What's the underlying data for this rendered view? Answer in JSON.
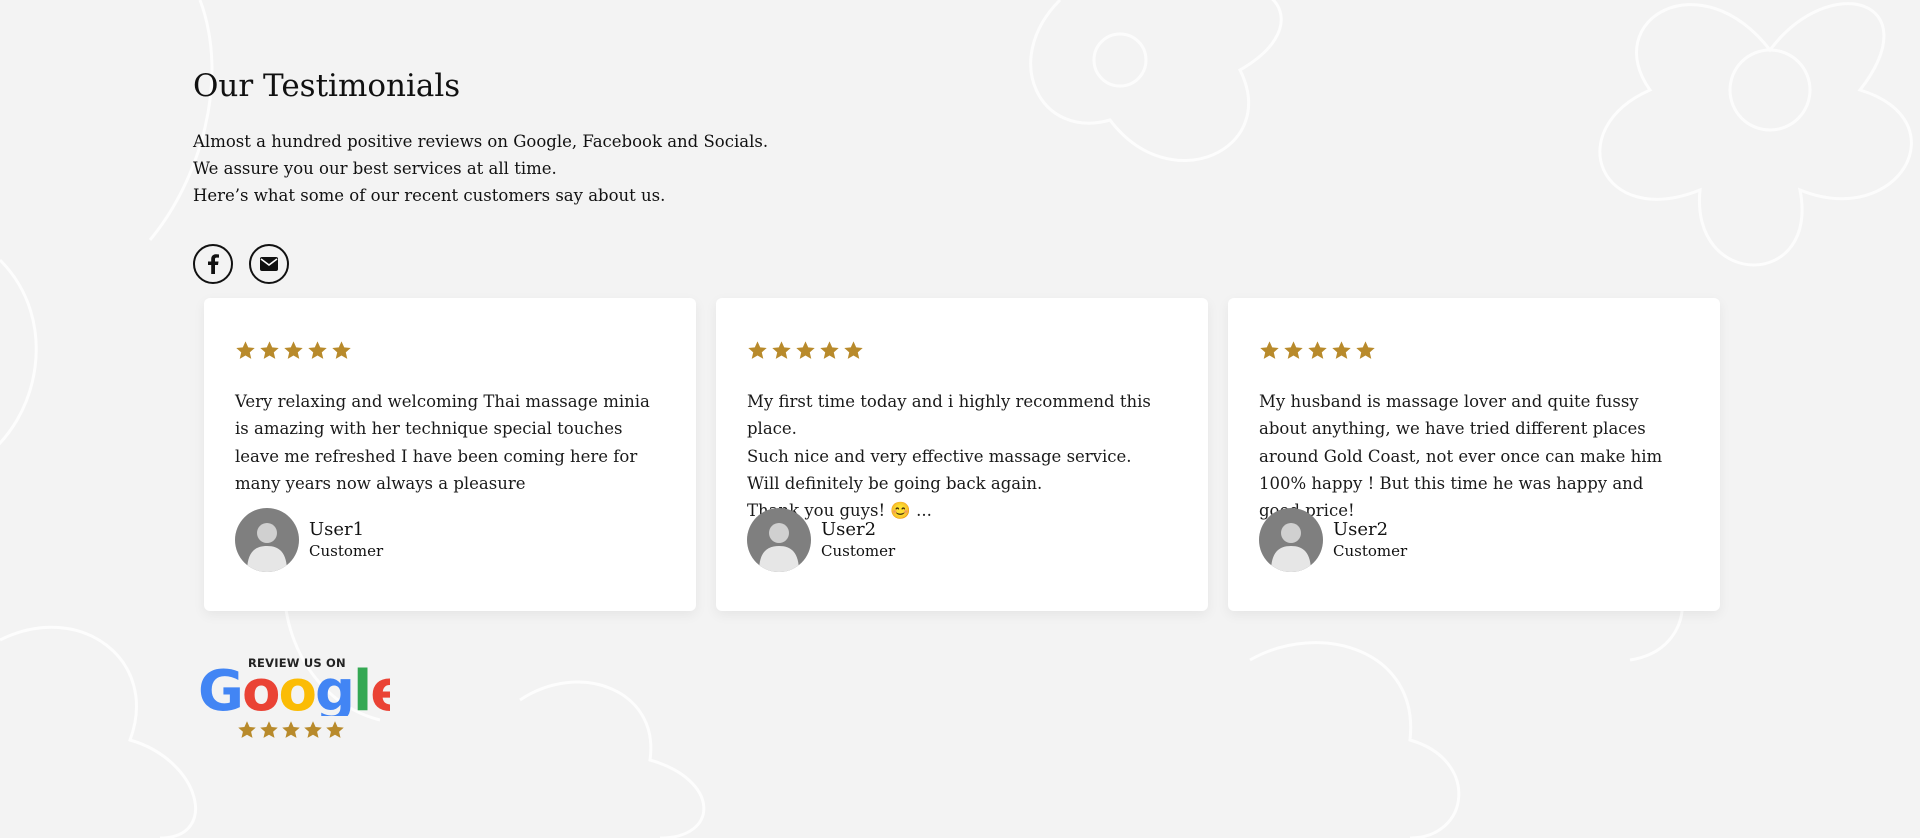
{
  "section": {
    "title": "Our Testimonials",
    "intro_lines": [
      "Almost a hundred positive reviews on Google, Facebook and Socials.",
      "We assure you our best services at all time.",
      "Here’s what some of our recent customers say about us."
    ]
  },
  "social": [
    {
      "icon": "facebook-icon"
    },
    {
      "icon": "envelope-icon"
    }
  ],
  "testimonials": [
    {
      "rating": 5,
      "quote": "Very relaxing and welcoming Thai massage minia is amazing with her technique special touches leave me refreshed I have been coming here for many years now always a pleasure",
      "name": "User1",
      "role": "Customer"
    },
    {
      "rating": 5,
      "quote_lines": [
        "My first time today and i highly recommend this place.",
        "Such nice and very effective massage service.",
        "Will definitely be going back again.",
        "Thank you guys! 😊 ..."
      ],
      "name": "User2",
      "role": "Customer"
    },
    {
      "rating": 5,
      "quote": "My husband is massage lover and quite fussy about anything, we have tried different places around Gold Coast, not ever once can make him 100% happy ! But this time he was happy and good price!",
      "name": "User2",
      "role": "Customer"
    }
  ],
  "google_badge": {
    "top_text": "REVIEW US ON",
    "brand_text": "Google",
    "rating": 5
  },
  "colors": {
    "star": "#b88a2b",
    "google_blue": "#4285F4",
    "google_red": "#EA4335",
    "google_yellow": "#FBBC05",
    "google_green": "#34A853"
  }
}
